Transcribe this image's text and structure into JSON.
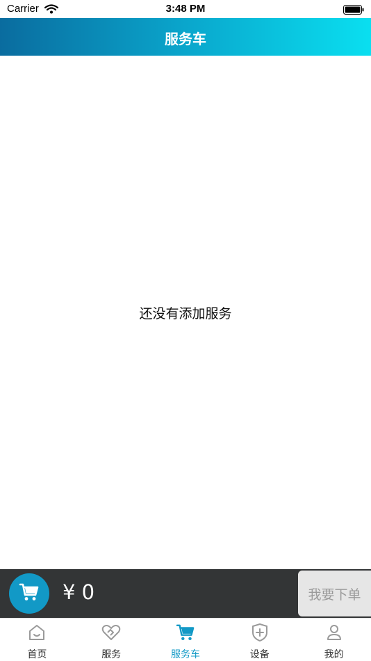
{
  "status_bar": {
    "carrier": "Carrier",
    "time": "3:48 PM"
  },
  "header": {
    "title": "服务车"
  },
  "content": {
    "empty_message": "还没有添加服务"
  },
  "checkout": {
    "total": "¥ 0",
    "order_label": "我要下单"
  },
  "tabs": [
    {
      "label": "首页",
      "icon": "home-icon",
      "active": false
    },
    {
      "label": "服务",
      "icon": "heart-service-icon",
      "active": false
    },
    {
      "label": "服务车",
      "icon": "cart-icon",
      "active": true
    },
    {
      "label": "设备",
      "icon": "shield-plus-icon",
      "active": false
    },
    {
      "label": "我的",
      "icon": "person-icon",
      "active": false
    }
  ],
  "colors": {
    "accent": "#1299c6",
    "header_start": "#0a6c9f",
    "header_end": "#0adff0",
    "checkout_bg": "#333536"
  }
}
